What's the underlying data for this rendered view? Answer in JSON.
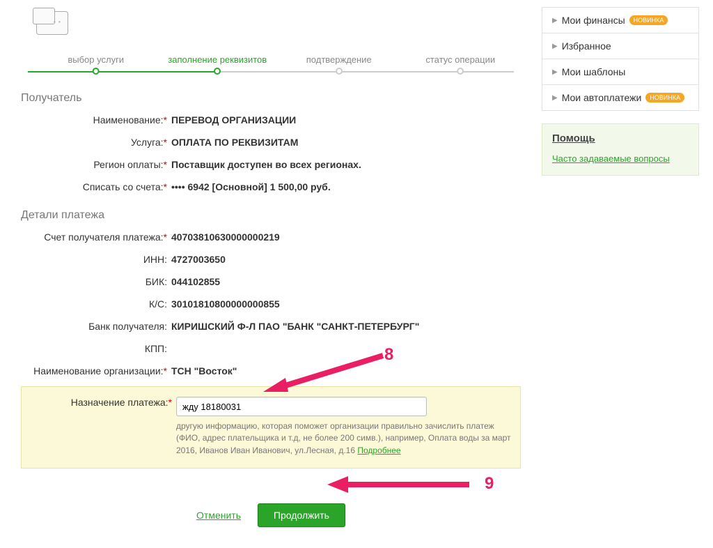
{
  "stepper": {
    "steps": [
      "выбор услуги",
      "заполнение реквизитов",
      "подтверждение",
      "статус операции"
    ]
  },
  "sections": {
    "recipient_title": "Получатель",
    "details_title": "Детали платежа"
  },
  "recipient": {
    "name_label": "Наименование:",
    "name_value": "ПЕРЕВОД ОРГАНИЗАЦИИ",
    "service_label": "Услуга:",
    "service_value": "ОПЛАТА ПО РЕКВИЗИТАМ",
    "region_label": "Регион оплаты:",
    "region_value": "Поставщик доступен во всех регионах.",
    "account_label": "Списать со счета:",
    "account_value": "•••• 6942  [Основной] 1 500,00   руб."
  },
  "details": {
    "recip_acct_label": "Счет получателя платежа:",
    "recip_acct_value": "40703810630000000219",
    "inn_label": "ИНН:",
    "inn_value": "4727003650",
    "bik_label": "БИК:",
    "bik_value": "044102855",
    "ks_label": "К/С:",
    "ks_value": "30101810800000000855",
    "bank_label": "Банк получателя:",
    "bank_value": "КИРИШСКИЙ Ф-Л ПАО \"БАНК \"САНКТ-ПЕТЕРБУРГ\"",
    "kpp_label": "КПП:",
    "kpp_value": "",
    "org_label": "Наименование организации:",
    "org_value": "ТСН \"Восток\"",
    "purpose_label": "Назначение платежа:",
    "purpose_value": "жду 18180031",
    "hint_text": "другую информацию, которая поможет организации правильно зачислить платеж (ФИО, адрес плательщика и т.д, не более 200 симв.), например, Оплата воды за март 2016, Иванов Иван Иванович, ул.Лесная, д.16 ",
    "hint_link": "Подробнее"
  },
  "actions": {
    "cancel": "Отменить",
    "continue": "Продолжить"
  },
  "sidebar": {
    "items": [
      {
        "label": "Мои финансы",
        "badge": "НОВИНКА"
      },
      {
        "label": "Избранное",
        "badge": ""
      },
      {
        "label": "Мои шаблоны",
        "badge": ""
      },
      {
        "label": "Мои автоплатежи",
        "badge": "НОВИНКА"
      }
    ],
    "help_title": "Помощь",
    "help_link": "Часто задаваемые вопросы"
  },
  "annotations": {
    "n8": "8",
    "n9": "9"
  }
}
